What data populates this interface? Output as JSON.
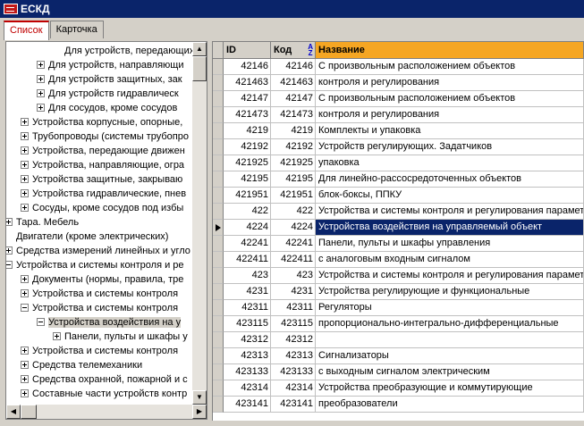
{
  "window": {
    "title": "ЕСКД"
  },
  "tabs": [
    "Список",
    "Карточка"
  ],
  "tree": [
    {
      "text": "Для устройств, передающих д",
      "indent": 3,
      "exp": ""
    },
    {
      "text": "Для устройств, направляющи",
      "indent": 2,
      "exp": "plus"
    },
    {
      "text": "Для устройств защитных, зак",
      "indent": 2,
      "exp": "plus"
    },
    {
      "text": "Для устройств гидравлическ",
      "indent": 2,
      "exp": "plus"
    },
    {
      "text": "Для сосудов, кроме сосудов",
      "indent": 2,
      "exp": "plus"
    },
    {
      "text": "Устройства корпусные, опорные,",
      "indent": 1,
      "exp": "plus"
    },
    {
      "text": "Трубопроводы (системы трубопро",
      "indent": 1,
      "exp": "plus"
    },
    {
      "text": "Устройства, передающие движен",
      "indent": 1,
      "exp": "plus"
    },
    {
      "text": "Устройства, направляющие, огра",
      "indent": 1,
      "exp": "plus"
    },
    {
      "text": "Устройства защитные, закрываю",
      "indent": 1,
      "exp": "plus"
    },
    {
      "text": "Устройства гидравлические, пнев",
      "indent": 1,
      "exp": "plus"
    },
    {
      "text": "Сосуды, кроме сосудов под избы",
      "indent": 1,
      "exp": "plus"
    },
    {
      "text": "Тара. Мебель",
      "indent": 0,
      "exp": "plus"
    },
    {
      "text": "Двигатели (кроме электрических)",
      "indent": 0,
      "exp": ""
    },
    {
      "text": "Средства измерений линейных и угло",
      "indent": 0,
      "exp": "plus"
    },
    {
      "text": "Устройства и системы контроля и ре",
      "indent": 0,
      "exp": "minus"
    },
    {
      "text": "Документы (нормы, правила, тре",
      "indent": 1,
      "exp": "plus"
    },
    {
      "text": "Устройства и системы контроля",
      "indent": 1,
      "exp": "plus"
    },
    {
      "text": "Устройства и системы контроля",
      "indent": 1,
      "exp": "minus"
    },
    {
      "text": "Устройства воздействия на у",
      "indent": 2,
      "exp": "minus",
      "selected": true
    },
    {
      "text": "Панели, пульты и шкафы у",
      "indent": 3,
      "exp": "plus"
    },
    {
      "text": "Устройства и системы контроля",
      "indent": 1,
      "exp": "plus"
    },
    {
      "text": "Средства телемеханики",
      "indent": 1,
      "exp": "plus"
    },
    {
      "text": "Средства охранной, пожарной и с",
      "indent": 1,
      "exp": "plus"
    },
    {
      "text": "Составные части устройств контр",
      "indent": 1,
      "exp": "plus"
    }
  ],
  "grid": {
    "headers": {
      "id": "ID",
      "kod": "Код",
      "name": "Название"
    },
    "rows": [
      {
        "id": "42146",
        "kod": "42146",
        "name": "С произвольным расположением объектов"
      },
      {
        "id": "421463",
        "kod": "421463",
        "name": "контроля и регулирования"
      },
      {
        "id": "42147",
        "kod": "42147",
        "name": "С произвольным расположением объектов"
      },
      {
        "id": "421473",
        "kod": "421473",
        "name": "контроля и регулирования"
      },
      {
        "id": "4219",
        "kod": "4219",
        "name": "Комплекты и упаковка"
      },
      {
        "id": "42192",
        "kod": "42192",
        "name": "Устройств регулирующих. Задатчиков"
      },
      {
        "id": "421925",
        "kod": "421925",
        "name": "упаковка"
      },
      {
        "id": "42195",
        "kod": "42195",
        "name": "Для линейно-рассосредоточенных объектов"
      },
      {
        "id": "421951",
        "kod": "421951",
        "name": "блок-боксы, ППКУ"
      },
      {
        "id": "422",
        "kod": "422",
        "name": "Устройства и системы контроля и регулирования параметр"
      },
      {
        "id": "4224",
        "kod": "4224",
        "name": "Устройства воздействия на управляемый объект",
        "selected": true
      },
      {
        "id": "42241",
        "kod": "42241",
        "name": "Панели, пульты и шкафы управления"
      },
      {
        "id": "422411",
        "kod": "422411",
        "name": "с аналоговым входным сигналом"
      },
      {
        "id": "423",
        "kod": "423",
        "name": "Устройства и системы контроля и регулирования параметр"
      },
      {
        "id": "4231",
        "kod": "4231",
        "name": "Устройства регулирующие и функциональные"
      },
      {
        "id": "42311",
        "kod": "42311",
        "name": "Регуляторы"
      },
      {
        "id": "423115",
        "kod": "423115",
        "name": "пропорционально-интегрально-дифференциальные"
      },
      {
        "id": "42312",
        "kod": "42312",
        "name": ""
      },
      {
        "id": "42313",
        "kod": "42313",
        "name": "Сигнализаторы"
      },
      {
        "id": "423133",
        "kod": "423133",
        "name": "с выходным сигналом электрическим"
      },
      {
        "id": "42314",
        "kod": "42314",
        "name": "Устройства преобразующие и коммутирующие"
      },
      {
        "id": "423141",
        "kod": "423141",
        "name": "преобразователи"
      }
    ]
  }
}
